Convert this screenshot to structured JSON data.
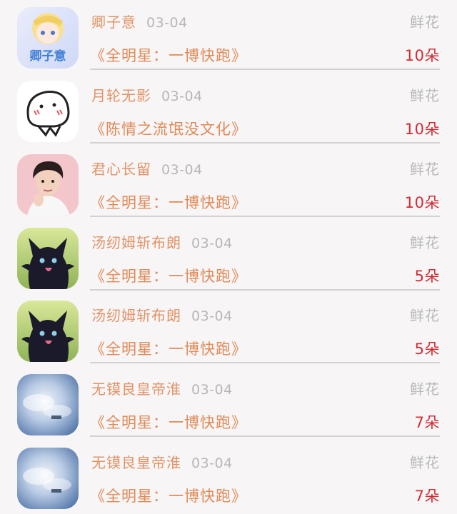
{
  "gifts": [
    {
      "user": "卿子意",
      "date": "03-04",
      "type": "鲜花",
      "book": "《全明星：一博快跑》",
      "amount": "10朵",
      "avatar": "anime-girl-avatar"
    },
    {
      "user": "月轮无影",
      "date": "03-04",
      "type": "鲜花",
      "book": "《陈情之流氓没文化》",
      "amount": "10朵",
      "avatar": "cartoon-face-avatar"
    },
    {
      "user": "君心长留",
      "date": "03-04",
      "type": "鲜花",
      "book": "《全明星：一博快跑》",
      "amount": "10朵",
      "avatar": "man-photo-avatar"
    },
    {
      "user": "汤纫姆斩布朗",
      "date": "03-04",
      "type": "鲜花",
      "book": "《全明星：一博快跑》",
      "amount": "5朵",
      "avatar": "black-creature-avatar"
    },
    {
      "user": "汤纫姆斩布朗",
      "date": "03-04",
      "type": "鲜花",
      "book": "《全明星：一博快跑》",
      "amount": "5朵",
      "avatar": "black-creature-avatar"
    },
    {
      "user": "无镆良皇帝淮",
      "date": "03-04",
      "type": "鲜花",
      "book": "《全明星：一博快跑》",
      "amount": "7朵",
      "avatar": "sky-clouds-avatar"
    },
    {
      "user": "无镆良皇帝淮",
      "date": "03-04",
      "type": "鲜花",
      "book": "《全明星：一博快跑》",
      "amount": "7朵",
      "avatar": "sky-clouds-avatar"
    }
  ]
}
